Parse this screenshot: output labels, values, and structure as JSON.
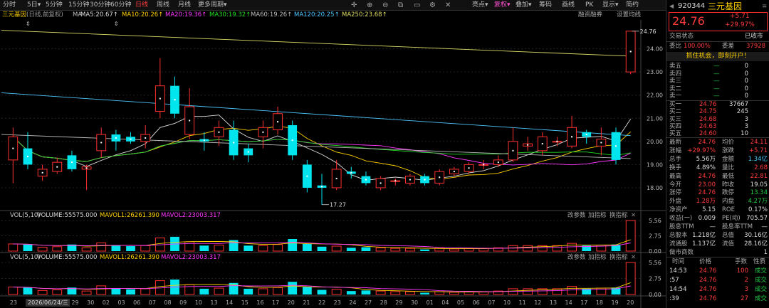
{
  "toolbar": {
    "left_items": [
      "分时",
      "5日",
      "5分钟",
      "15分钟",
      "30分钟",
      "60分钟",
      "日线",
      "周线",
      "月线",
      "更多周期"
    ],
    "right_items": [
      "亮点",
      "复权",
      "叠加",
      "筹码",
      "画线",
      "PK",
      "显示",
      "简约"
    ],
    "tool_icons": [
      "✛",
      "⊕",
      "⊖",
      "⧉",
      "▭",
      "⚙",
      "✕"
    ],
    "active": "日线"
  },
  "ma_bar": {
    "stock": "三元基因",
    "period": "(日线,前复权)",
    "ma_label": "MA",
    "ma": [
      {
        "text": "MA5:20.67",
        "color": "#dddddd"
      },
      {
        "text": "MA10:20.26",
        "color": "#ffd200"
      },
      {
        "text": "MA20:19.36",
        "color": "#ff38ff"
      },
      {
        "text": "MA30:19.32",
        "color": "#22dd22"
      },
      {
        "text": "MA60:19.26",
        "color": "#bbbbbb"
      },
      {
        "text": "MA120:20.25",
        "color": "#4cc8ff"
      },
      {
        "text": "MA250:23.68",
        "color": "#dddd66"
      }
    ],
    "right1": "融资融券",
    "right2": "设置均线"
  },
  "price_axis": [
    "24.00",
    "23.00",
    "22.00",
    "21.00",
    "20.00",
    "19.00",
    "18.00"
  ],
  "annotations": {
    "high": "24.76",
    "low": "17.27"
  },
  "vol_panels": [
    {
      "label": "VOL(5,10)",
      "volume": "VOLUME:55575.000",
      "m1": "MAVOL1:26261.390",
      "m2": "MAVOL2:23003.317",
      "btns": [
        "改参数",
        "加指标",
        "换指标"
      ]
    },
    {
      "label": "VOL(5,10)",
      "volume": "VOLUME:55575.000",
      "m1": "MAVOL1:26261.390",
      "m2": "MAVOL2:23003.317",
      "btns": [
        "改参数",
        "加指标",
        "换指标"
      ]
    }
  ],
  "vol_axis": [
    "5.56",
    "2.75",
    "0.00"
  ],
  "x_dates": [
    "23",
    "24",
    "25",
    "26",
    "29",
    "30",
    "02",
    "03",
    "06",
    "07",
    "08",
    "09",
    "10",
    "13",
    "14",
    "15",
    "16",
    "17",
    "20",
    "21",
    "22",
    "23",
    "24",
    "27",
    "28",
    "29",
    "30",
    "01",
    "04",
    "05",
    "06",
    "07",
    "10",
    "11",
    "12",
    "13",
    "14",
    "17",
    "18",
    "19",
    "20"
  ],
  "date_tag": "2026/06/24/三",
  "chart_data": {
    "type": "candlestick",
    "candles": [
      {
        "o": 19.2,
        "c": 20.2,
        "h": 20.6,
        "l": 18.2
      },
      {
        "o": 19.7,
        "c": 19.0,
        "h": 20.4,
        "l": 18.8
      },
      {
        "o": 18.5,
        "c": 18.8,
        "h": 19.0,
        "l": 18.3
      },
      {
        "o": 18.7,
        "c": 19.1,
        "h": 19.3,
        "l": 18.6
      },
      {
        "o": 19.4,
        "c": 18.8,
        "h": 19.6,
        "l": 18.7
      },
      {
        "o": 18.8,
        "c": 18.9,
        "h": 19.0,
        "l": 17.9
      },
      {
        "o": 19.6,
        "c": 20.3,
        "h": 20.6,
        "l": 19.3
      },
      {
        "o": 20.3,
        "c": 20.0,
        "h": 20.5,
        "l": 19.6
      },
      {
        "o": 20.2,
        "c": 20.0,
        "h": 20.4,
        "l": 19.9
      },
      {
        "o": 20.0,
        "c": 20.3,
        "h": 20.7,
        "l": 19.7
      },
      {
        "o": 21.3,
        "c": 22.4,
        "h": 23.6,
        "l": 21.0
      },
      {
        "o": 22.4,
        "c": 21.2,
        "h": 22.8,
        "l": 21.0
      },
      {
        "o": 20.3,
        "c": 21.5,
        "h": 22.3,
        "l": 20.1
      },
      {
        "o": 20.1,
        "c": 20.0,
        "h": 20.4,
        "l": 19.6
      },
      {
        "o": 20.2,
        "c": 20.6,
        "h": 20.9,
        "l": 19.8
      },
      {
        "o": 20.5,
        "c": 19.4,
        "h": 20.9,
        "l": 19.2
      },
      {
        "o": 19.7,
        "c": 19.4,
        "h": 19.9,
        "l": 19.1
      },
      {
        "o": 20.2,
        "c": 20.6,
        "h": 20.9,
        "l": 19.7
      },
      {
        "o": 20.5,
        "c": 21.2,
        "h": 21.5,
        "l": 20.3
      },
      {
        "o": 20.7,
        "c": 19.4,
        "h": 20.9,
        "l": 19.2
      },
      {
        "o": 19.0,
        "c": 18.0,
        "h": 19.2,
        "l": 17.8
      },
      {
        "o": 18.1,
        "c": 18.0,
        "h": 18.6,
        "l": 17.27
      },
      {
        "o": 18.0,
        "c": 18.8,
        "h": 19.2,
        "l": 17.9
      },
      {
        "o": 18.7,
        "c": 18.6,
        "h": 18.9,
        "l": 18.4
      },
      {
        "o": 18.5,
        "c": 18.2,
        "h": 18.7,
        "l": 18.1
      },
      {
        "o": 18.0,
        "c": 18.4,
        "h": 18.5,
        "l": 17.9
      },
      {
        "o": 18.3,
        "c": 18.3,
        "h": 18.4,
        "l": 18.1
      },
      {
        "o": 18.2,
        "c": 18.5,
        "h": 18.6,
        "l": 18.1
      },
      {
        "o": 18.5,
        "c": 18.2,
        "h": 18.6,
        "l": 18.1
      },
      {
        "o": 18.2,
        "c": 18.7,
        "h": 18.8,
        "l": 18.1
      },
      {
        "o": 18.6,
        "c": 18.8,
        "h": 18.9,
        "l": 18.5
      },
      {
        "o": 18.7,
        "c": 19.0,
        "h": 19.1,
        "l": 18.6
      },
      {
        "o": 19.0,
        "c": 19.0,
        "h": 19.2,
        "l": 18.8
      },
      {
        "o": 19.0,
        "c": 19.2,
        "h": 19.4,
        "l": 18.9
      },
      {
        "o": 19.2,
        "c": 20.0,
        "h": 20.6,
        "l": 19.1
      },
      {
        "o": 19.8,
        "c": 19.9,
        "h": 20.2,
        "l": 19.6
      },
      {
        "o": 19.6,
        "c": 20.2,
        "h": 20.4,
        "l": 19.4
      },
      {
        "o": 20.0,
        "c": 20.0,
        "h": 20.2,
        "l": 19.8
      },
      {
        "o": 19.8,
        "c": 20.6,
        "h": 21.1,
        "l": 19.7
      },
      {
        "o": 20.4,
        "c": 20.2,
        "h": 20.5,
        "l": 19.9
      },
      {
        "o": 19.8,
        "c": 20.1,
        "h": 20.6,
        "l": 19.4
      },
      {
        "o": 20.4,
        "c": 19.2,
        "h": 20.6,
        "l": 19.0
      },
      {
        "o": 23.0,
        "c": 24.76,
        "h": 24.76,
        "l": 22.9
      }
    ],
    "volumes": [
      1.3,
      1.2,
      0.7,
      0.8,
      1.2,
      0.6,
      1.5,
      1.1,
      0.9,
      1.0,
      2.4,
      2.6,
      1.7,
      1.0,
      1.1,
      2.0,
      1.0,
      1.0,
      1.2,
      2.2,
      1.3,
      0.8,
      0.9,
      0.6,
      0.7,
      0.6,
      0.5,
      0.5,
      0.3,
      0.5,
      0.4,
      0.5,
      0.5,
      0.6,
      1.0,
      1.0,
      1.0,
      1.0,
      1.4,
      1.0,
      1.1,
      1.2,
      5.56
    ],
    "price_range": [
      17.2,
      25.0
    ],
    "vol_range": [
      0,
      5.56
    ]
  },
  "quote": {
    "code": "920344",
    "name": "三元基因",
    "price": "24.76",
    "change": "+5.71",
    "pct": "+29.97%",
    "status_label": "交易状态",
    "status_value": "已收市",
    "weibi_label": "委比",
    "weibi_value": "100.00%",
    "weicha_label": "委差",
    "weicha_value": "37928",
    "promo": "抓住机会，即刻开户！",
    "sells": [
      {
        "label": "卖五",
        "price": "—",
        "vol": "0"
      },
      {
        "label": "卖四",
        "price": "—",
        "vol": "0"
      },
      {
        "label": "卖三",
        "price": "—",
        "vol": "0"
      },
      {
        "label": "卖二",
        "price": "—",
        "vol": "0"
      },
      {
        "label": "卖一",
        "price": "—",
        "vol": "0"
      }
    ],
    "buys": [
      {
        "label": "买一",
        "price": "24.76",
        "vol": "37667"
      },
      {
        "label": "买二",
        "price": "24.75",
        "vol": "245"
      },
      {
        "label": "买三",
        "price": "24.68",
        "vol": "3"
      },
      {
        "label": "买四",
        "price": "24.63",
        "vol": "3"
      },
      {
        "label": "买五",
        "price": "24.60",
        "vol": "10"
      }
    ],
    "stats": [
      [
        {
          "t": "最新",
          "c": "gray"
        },
        {
          "t": "24.76",
          "c": "red"
        },
        {
          "t": "均价",
          "c": "gray"
        },
        {
          "t": "24.11",
          "c": "red"
        }
      ],
      [
        {
          "t": "涨幅",
          "c": "gray"
        },
        {
          "t": "+29.97%",
          "c": "red"
        },
        {
          "t": "涨跌",
          "c": "gray"
        },
        {
          "t": "+5.71",
          "c": "red"
        }
      ],
      [
        {
          "t": "总手",
          "c": "gray"
        },
        {
          "t": "5.56万",
          "c": "white"
        },
        {
          "t": "金额",
          "c": "gray"
        },
        {
          "t": "1.34亿",
          "c": "cyan"
        }
      ],
      [
        {
          "t": "换手",
          "c": "gray"
        },
        {
          "t": "4.89%",
          "c": "white"
        },
        {
          "t": "量比",
          "c": "gray"
        },
        {
          "t": "2.68",
          "c": "red"
        }
      ],
      [
        {
          "t": "最高",
          "c": "gray"
        },
        {
          "t": "24.76",
          "c": "red"
        },
        {
          "t": "最低",
          "c": "gray"
        },
        {
          "t": "22.81",
          "c": "red"
        }
      ],
      [
        {
          "t": "今开",
          "c": "gray"
        },
        {
          "t": "23.00",
          "c": "red"
        },
        {
          "t": "昨收",
          "c": "gray"
        },
        {
          "t": "19.05",
          "c": "white"
        }
      ],
      [
        {
          "t": "涨停",
          "c": "gray"
        },
        {
          "t": "24.76",
          "c": "red"
        },
        {
          "t": "跌停",
          "c": "gray"
        },
        {
          "t": "13.34",
          "c": "green"
        }
      ],
      [
        {
          "t": "外盘",
          "c": "gray"
        },
        {
          "t": "1.28万",
          "c": "red"
        },
        {
          "t": "内盘",
          "c": "gray"
        },
        {
          "t": "4.27万",
          "c": "green"
        }
      ],
      [
        {
          "t": "净资产",
          "c": "gray"
        },
        {
          "t": "5.15",
          "c": "white"
        },
        {
          "t": "ROE",
          "c": "gray"
        },
        {
          "t": "0.17%",
          "c": "white"
        }
      ],
      [
        {
          "t": "收益(一)",
          "c": "gray"
        },
        {
          "t": "0.009",
          "c": "white"
        },
        {
          "t": "PE(动)",
          "c": "gray"
        },
        {
          "t": "705.57",
          "c": "white"
        }
      ],
      [
        {
          "t": "股息TTM",
          "c": "gray"
        },
        {
          "t": "—",
          "c": "white"
        },
        {
          "t": "股息率TTM",
          "c": "gray"
        },
        {
          "t": "—",
          "c": "white"
        }
      ],
      [
        {
          "t": "总股本",
          "c": "gray"
        },
        {
          "t": "1.218亿",
          "c": "white"
        },
        {
          "t": "总值",
          "c": "gray"
        },
        {
          "t": "30.16亿",
          "c": "white"
        }
      ],
      [
        {
          "t": "流通股",
          "c": "gray"
        },
        {
          "t": "1.137亿",
          "c": "white"
        },
        {
          "t": "流值",
          "c": "gray"
        },
        {
          "t": "28.16亿",
          "c": "white"
        }
      ],
      [
        {
          "t": "做市商数",
          "c": "gray"
        },
        {
          "t": "",
          "c": "white"
        },
        {
          "t": "",
          "c": "gray"
        },
        {
          "t": "1",
          "c": "white"
        }
      ]
    ],
    "trade_headers": [
      "时间",
      "价格",
      "手数",
      "性质"
    ],
    "trades": [
      {
        "time": "14:53",
        "price": "24.76",
        "vol": "100",
        "type": "成交"
      },
      {
        "time": ":57",
        "price": "24.76",
        "vol": "2",
        "type": "成交"
      },
      {
        "time": "14:54",
        "price": "24.76",
        "vol": "3",
        "type": "成交"
      },
      {
        "time": ":39",
        "price": "24.76",
        "vol": "27",
        "type": "成交"
      }
    ]
  }
}
